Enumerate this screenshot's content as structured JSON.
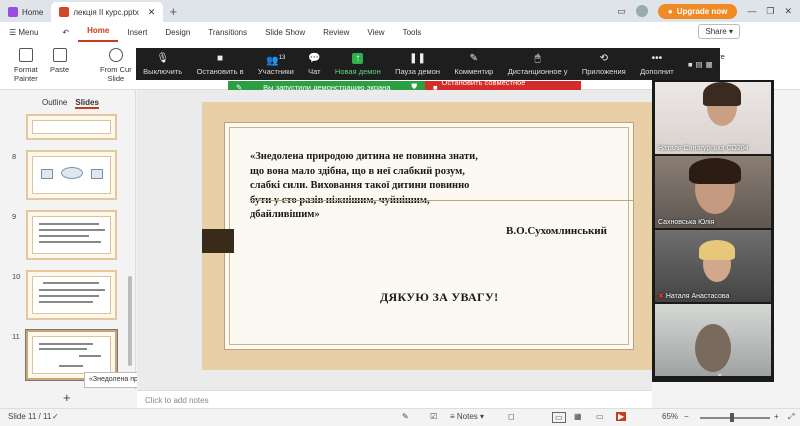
{
  "browser": {
    "home_tab": "Home",
    "doc_tab": "лекція ІІ курс.pptx",
    "new_tab": "+",
    "upgrade": "Upgrade now"
  },
  "menu": {
    "hamburger": "☰ Menu",
    "items": [
      "Home",
      "Insert",
      "Design",
      "Transitions",
      "Slide Show",
      "Review",
      "View",
      "Tools"
    ],
    "active": "Home",
    "share": "Share"
  },
  "ribbon": {
    "format_painter": "Format\nPainter",
    "paste": "Paste",
    "from_current": "From Cur\nSlide",
    "picture": "Picture"
  },
  "zoom_toolbar": {
    "items": [
      {
        "icon": "microphone",
        "label": "Выключить"
      },
      {
        "icon": "camera",
        "label": "Остановить в"
      },
      {
        "icon": "people",
        "label": "Участники",
        "count": "13"
      },
      {
        "icon": "chat",
        "label": "Чат"
      },
      {
        "icon": "share-screen",
        "label": "Новая демон"
      },
      {
        "icon": "pause",
        "label": "Пауза демон"
      },
      {
        "icon": "annotate",
        "label": "Комментир"
      },
      {
        "icon": "remote",
        "label": "Дистанционное у"
      },
      {
        "icon": "apps",
        "label": "Приложения"
      },
      {
        "icon": "more",
        "label": "Дополнит"
      }
    ]
  },
  "share_notice": {
    "running": "Вы запустили демонстрацию экрана",
    "stop": "Остановить совместное использование"
  },
  "panel": {
    "outline": "Outline",
    "slides": "Slides",
    "thumb_numbers": [
      "8",
      "9",
      "10",
      "11"
    ],
    "tooltip": "«Знедолена природою дитина не ...",
    "add": "+"
  },
  "slide": {
    "quote": "«Знедолена природою дитина не повинна знати,\nщо вона мало здібна, що в неї слабкий розум,\nслабкі сили. Виховання такої дитини повинно\nбути  у сто разів ніжнішим, чуйнішим,\nдбайливішим»",
    "author": "В.О.Сухомлинський",
    "thanks": "ДЯКУЮ ЗА УВАГУ!"
  },
  "notes_placeholder": "Click to add notes",
  "participants": [
    {
      "name": "Наталя Санагурська СО204"
    },
    {
      "name": "Сахновська Юлія"
    },
    {
      "name": "Наталя Анастасова"
    },
    {
      "name": ""
    }
  ],
  "status": {
    "slide": "Slide 11 / 11",
    "notes": "Notes",
    "zoom": "65%"
  },
  "colors": {
    "accent": "#c43e1c",
    "zoom_bg": "#1e1e1e",
    "share_green": "#2e9e44",
    "share_red": "#d62b2b",
    "upgrade": "#f08a24"
  }
}
